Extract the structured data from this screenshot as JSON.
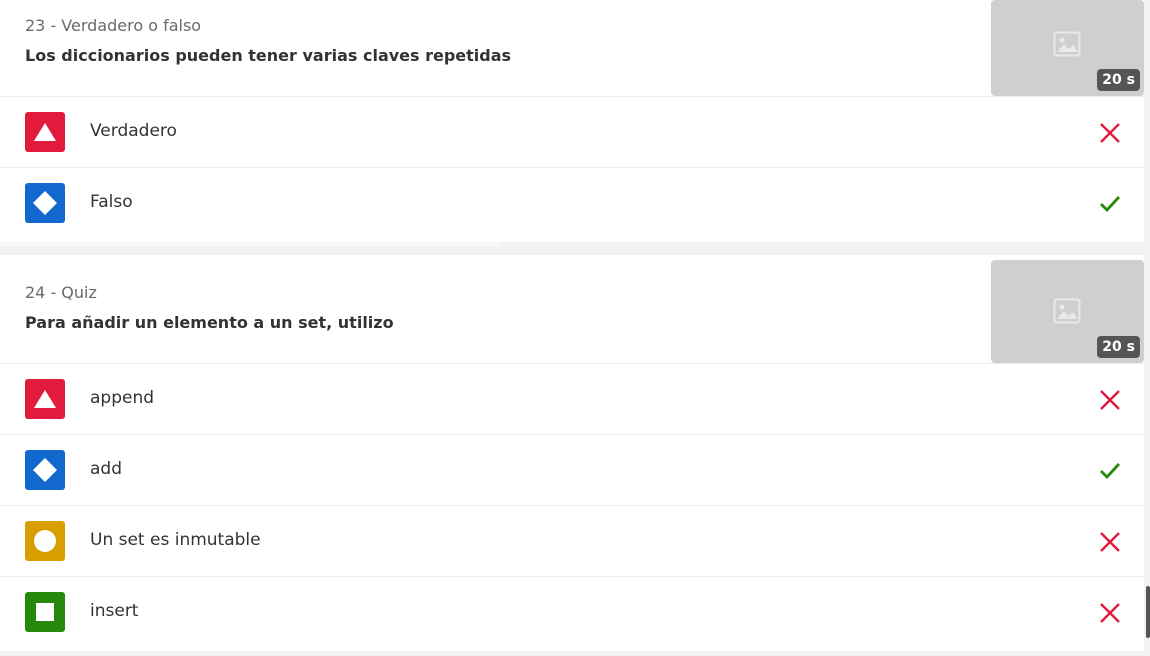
{
  "questions": [
    {
      "meta": "23 - Verdadero o falso",
      "title": "Los diccionarios pueden tener varias claves repetidas",
      "time": "20 s",
      "thumb_icon": "image-placeholder-icon",
      "answers": [
        {
          "label": "Verdadero",
          "shape": "triangle-icon",
          "color": "#e21b3c",
          "correct": false
        },
        {
          "label": "Falso",
          "shape": "diamond-icon",
          "color": "#1368ce",
          "correct": true
        }
      ]
    },
    {
      "meta": "24 - Quiz",
      "title": "Para añadir un elemento a un set, utilizo",
      "time": "20 s",
      "thumb_icon": "image-placeholder-icon",
      "answers": [
        {
          "label": "append",
          "shape": "triangle-icon",
          "color": "#e21b3c",
          "correct": false
        },
        {
          "label": "add",
          "shape": "diamond-icon",
          "color": "#1368ce",
          "correct": true
        },
        {
          "label": "Un set es inmutable",
          "shape": "circle-icon",
          "color": "#d89e00",
          "correct": false
        },
        {
          "label": "insert",
          "shape": "square-icon",
          "color": "#26890c",
          "correct": false
        }
      ]
    }
  ],
  "colors": {
    "wrong": "#e21b3c",
    "right": "#26890c"
  }
}
